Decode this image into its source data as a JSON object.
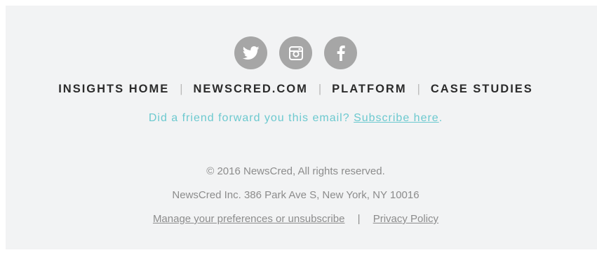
{
  "social": [
    {
      "icon": "twitter-icon"
    },
    {
      "icon": "instagram-icon"
    },
    {
      "icon": "facebook-icon"
    }
  ],
  "nav": {
    "items": [
      "INSIGHTS HOME",
      "NEWSCRED.COM",
      "PLATFORM",
      "CASE STUDIES"
    ],
    "separator": "|"
  },
  "forward": {
    "text": "Did a friend forward you this email? ",
    "link": "Subscribe here",
    "end": "."
  },
  "legal": {
    "copyright": "© 2016 NewsCred, All rights reserved.",
    "address": "NewsCred Inc. 386 Park Ave S, New York, NY 10016",
    "manage_link": "Manage your preferences or unsubscribe",
    "separator": "|",
    "privacy_link": "Privacy Policy"
  },
  "colors": {
    "background": "#f2f3f4",
    "icon_circle": "#a6a6a6",
    "accent": "#6cc9cf",
    "nav_text": "#2b2b2b",
    "legal_text": "#8c8c8c"
  }
}
